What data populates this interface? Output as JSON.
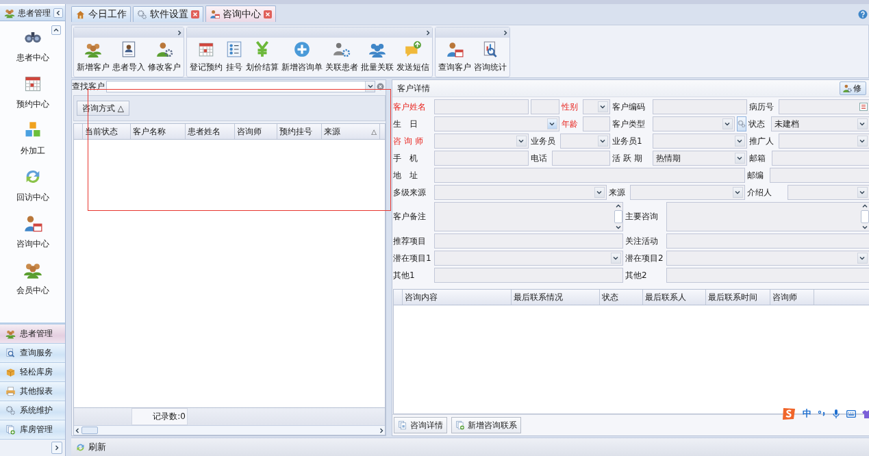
{
  "sidebar": {
    "title": "患者管理",
    "items": [
      {
        "label": "患者中心"
      },
      {
        "label": "预约中心"
      },
      {
        "label": "外加工"
      },
      {
        "label": "回访中心"
      },
      {
        "label": "咨询中心"
      },
      {
        "label": "会员中心"
      }
    ],
    "modules": [
      {
        "label": "患者管理",
        "selected": true
      },
      {
        "label": "查询服务",
        "selected": false
      },
      {
        "label": "轻松库房",
        "selected": false
      },
      {
        "label": "其他报表",
        "selected": false
      },
      {
        "label": "系统维护",
        "selected": false
      },
      {
        "label": "库房管理",
        "selected": false
      }
    ]
  },
  "tabs": [
    {
      "label": "今日工作",
      "selected": false,
      "closable": false
    },
    {
      "label": "软件设置",
      "selected": false,
      "closable": true
    },
    {
      "label": "咨询中心",
      "selected": true,
      "closable": true
    }
  ],
  "ribbon": [
    {
      "buttons": [
        "新增客户",
        "患者导入",
        "修改客户"
      ]
    },
    {
      "buttons": [
        "登记预约",
        "挂号",
        "划价结算",
        "新增咨询单",
        "关联患者",
        "批量关联",
        "发送短信"
      ]
    },
    {
      "buttons": [
        "查询客户",
        "咨询统计"
      ]
    }
  ],
  "left_panel": {
    "search_label": "查找客户",
    "group_button": {
      "label": "咨询方式",
      "sort": "△"
    },
    "columns": [
      {
        "label": "当前状态"
      },
      {
        "label": "客户名称"
      },
      {
        "label": "患者姓名"
      },
      {
        "label": "咨询师"
      },
      {
        "label": "预约挂号"
      },
      {
        "label": "来源",
        "sort": "△"
      }
    ],
    "record_count": "记录数:0"
  },
  "detail": {
    "title": "客户详情",
    "edit_button": "修",
    "rows": [
      {
        "fields": [
          {
            "kind": "label",
            "text": "客户姓名",
            "required": true
          },
          {
            "kind": "text"
          },
          {
            "kind": "text"
          },
          {
            "kind": "label",
            "text": "性别",
            "required": true
          },
          {
            "kind": "combo"
          },
          {
            "kind": "label",
            "text": "客户编码",
            "required": false
          },
          {
            "kind": "text"
          },
          {
            "kind": "label",
            "text": "病历号",
            "required": false
          },
          {
            "kind": "list"
          }
        ]
      },
      {
        "fields": [
          {
            "kind": "label",
            "text": "生　日",
            "required": false
          },
          {
            "kind": "date"
          },
          {
            "kind": "label",
            "text": "年龄",
            "required": true
          },
          {
            "kind": "text"
          },
          {
            "kind": "label",
            "text": "客户类型",
            "required": false
          },
          {
            "kind": "combo"
          },
          {
            "kind": "gear"
          },
          {
            "kind": "label",
            "text": "状态",
            "required": false
          },
          {
            "kind": "combo",
            "value": "未建档"
          }
        ]
      },
      {
        "fields": [
          {
            "kind": "label",
            "text": "咨 询 师",
            "required": true
          },
          {
            "kind": "combo"
          },
          {
            "kind": "label",
            "text": "业务员",
            "required": false
          },
          {
            "kind": "combo"
          },
          {
            "kind": "label",
            "text": "业务员1",
            "required": false
          },
          {
            "kind": "combo"
          },
          {
            "kind": "label",
            "text": "推广人",
            "required": false
          },
          {
            "kind": "combo"
          }
        ]
      },
      {
        "fields": [
          {
            "kind": "label",
            "text": "手　机",
            "required": false
          },
          {
            "kind": "text"
          },
          {
            "kind": "label",
            "text": "电话",
            "required": false
          },
          {
            "kind": "text"
          },
          {
            "kind": "label",
            "text": "活 跃 期",
            "required": false
          },
          {
            "kind": "combo",
            "value": "热情期"
          },
          {
            "kind": "label",
            "text": "邮箱",
            "required": false
          },
          {
            "kind": "text"
          }
        ]
      },
      {
        "fields": [
          {
            "kind": "label",
            "text": "地　址",
            "required": false
          },
          {
            "kind": "text"
          },
          {
            "kind": "label",
            "text": "邮编",
            "required": false
          },
          {
            "kind": "text"
          }
        ]
      },
      {
        "fields": [
          {
            "kind": "label",
            "text": "多级来源",
            "required": false
          },
          {
            "kind": "combo"
          },
          {
            "kind": "label",
            "text": "来源",
            "required": false
          },
          {
            "kind": "combo"
          },
          {
            "kind": "label",
            "text": "介绍人",
            "required": false
          },
          {
            "kind": "combo"
          }
        ]
      },
      {
        "fields": [
          {
            "kind": "label",
            "text": "客户备注",
            "required": false
          },
          {
            "kind": "memo"
          },
          {
            "kind": "label",
            "text": "主要咨询",
            "required": false
          },
          {
            "kind": "memo"
          }
        ]
      },
      {
        "fields": [
          {
            "kind": "label",
            "text": "推荐项目",
            "required": false
          },
          {
            "kind": "text"
          },
          {
            "kind": "label",
            "text": "关注活动",
            "required": false
          },
          {
            "kind": "text"
          }
        ]
      },
      {
        "fields": [
          {
            "kind": "label",
            "text": "潜在项目1",
            "required": false
          },
          {
            "kind": "combo"
          },
          {
            "kind": "label",
            "text": "潜在项目2",
            "required": false
          },
          {
            "kind": "combo"
          }
        ]
      },
      {
        "fields": [
          {
            "kind": "label",
            "text": "其他1",
            "required": false
          },
          {
            "kind": "text"
          },
          {
            "kind": "label",
            "text": "其他2",
            "required": false
          },
          {
            "kind": "text"
          }
        ]
      }
    ],
    "columns": [
      "咨询内容",
      "最后联系情况",
      "状态",
      "最后联系人",
      "最后联系时间",
      "咨询师"
    ],
    "buttons": [
      "咨询详情",
      "新增咨询联系"
    ]
  },
  "bottom_bar": {
    "refresh": "刷新"
  },
  "ime_bar": {
    "mode": "中"
  }
}
